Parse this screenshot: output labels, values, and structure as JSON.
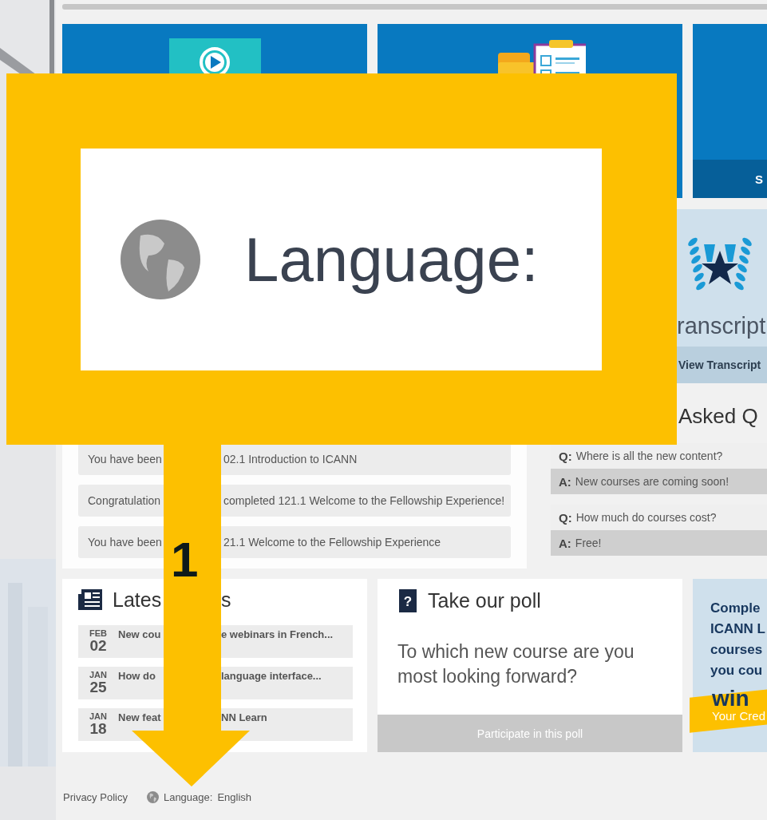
{
  "tiles": [
    {
      "kind": "video"
    },
    {
      "kind": "tasks"
    },
    {
      "kind": "plain",
      "caption": "S"
    }
  ],
  "notifications": [
    {
      "start": "You have been",
      "end": "02.1 Introduction to ICANN"
    },
    {
      "start": "Congratulation",
      "end": "completed 121.1 Welcome to the Fellowship Experience!"
    },
    {
      "start": "You have been",
      "end": "21.1 Welcome to the Fellowship Experience"
    }
  ],
  "transcript": {
    "title": "ranscript",
    "button": "View Transcript"
  },
  "faq": {
    "heading": "Asked Q",
    "items": [
      {
        "q_label": "Q:",
        "question": "Where is all the new content?",
        "a_label": "A:",
        "answer": "New courses are coming soon!"
      },
      {
        "q_label": "Q:",
        "question": "How much do courses cost?",
        "a_label": "A:",
        "answer": "Free!"
      }
    ]
  },
  "news": {
    "heading_start": "Lates",
    "heading_end": "s",
    "items": [
      {
        "month": "FEB",
        "day": "02",
        "title_start": "New cou",
        "title_end": "e webinars in French..."
      },
      {
        "month": "JAN",
        "day": "25",
        "title_start": "How do",
        "title_end": "language interface..."
      },
      {
        "month": "JAN",
        "day": "18",
        "title_start": "New feat",
        "title_end": "NN Learn"
      }
    ]
  },
  "poll": {
    "icon": "?",
    "heading": "Take our poll",
    "question": "To which new course are you most looking forward?",
    "button": "Participate in this poll"
  },
  "promo": {
    "lines": [
      "Comple",
      "ICANN L",
      "courses",
      "you cou"
    ],
    "banner": "win",
    "banner_sub": "Your Cred"
  },
  "footer": {
    "privacy": "Privacy Policy",
    "language_label": "Language:",
    "language": "English"
  },
  "annotation": {
    "zoom_text": "Language:",
    "step": "1"
  }
}
